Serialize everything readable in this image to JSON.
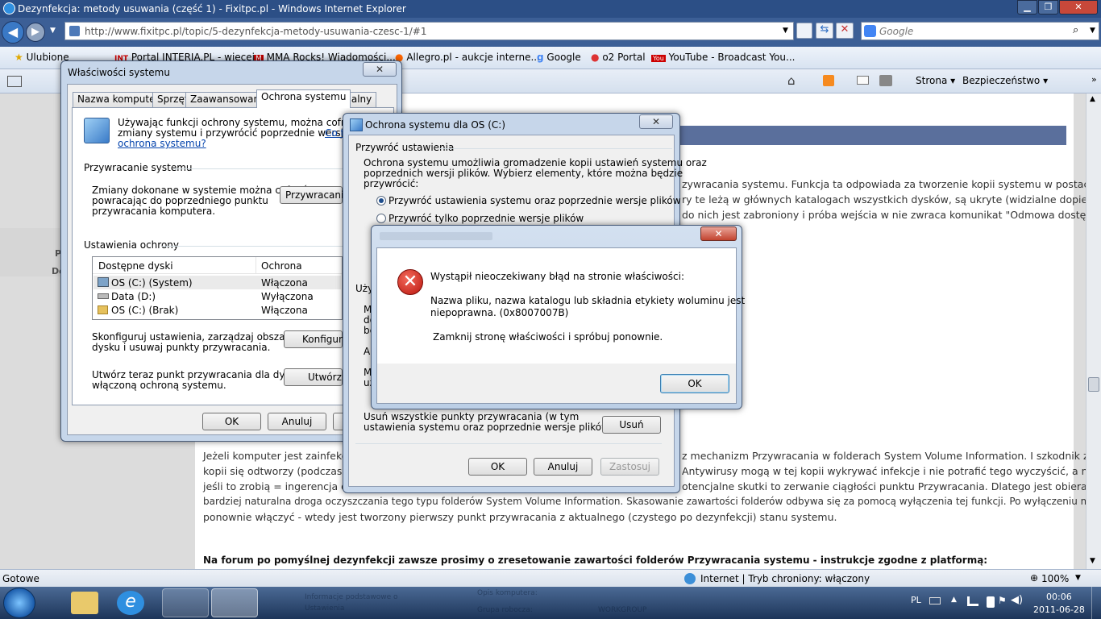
{
  "browser": {
    "title": "Dezynfekcja: metody usuwania (część 1) - Fixitpc.pl - Windows Internet Explorer",
    "url": "http://www.fixitpc.pl/topic/5-dezynfekcja-metody-usuwania-czesc-1/#1",
    "search_placeholder": "Google",
    "favorites_label": "Ulubione",
    "favorites": [
      "Portal INTERIA.PL - więcej...",
      "MMA Rocks! Wiadomości...",
      "Allegro.pl - aukcje interne...",
      "Google",
      "o2 Portal",
      "YouTube - Broadcast You..."
    ],
    "cmd_page": "Strona",
    "cmd_security": "Bezpieczeństwo",
    "status_left": "Gotowe",
    "status_zone": "Internet | Tryb chroniony: włączony",
    "zoom": "100%"
  },
  "page": {
    "right_lines": [
      "zywracania systemu. Funkcja ta odpowiada za tworzenie kopii systemu w postaci tzw.",
      "ry te leżą w głównych katalogach wszystkich dysków, są ukryte (widzialne dopiero po",
      "do nich jest zabroniony i próba wejścia w nie zwraca komunikat \"Odmowa dostępu\"."
    ],
    "bottom_lines": [
      "Jeżeli komputer jest zainfekowa",
      "kopii się odtworzy (podczas pro",
      "jeśli to zrobią = ingerencja opro",
      "bardziej naturalna droga oczyszczania tego typu folderów System Volume Information. Skasowanie zawartości folderów odbywa się za pomocą wyłączenia tej funkcji. Po wyłączeniu można ją",
      "ponownie włączyć - wtedy jest tworzony pierwszy punkt przywracania z aktualnego (czystego po dezynfekcji) stanu systemu."
    ],
    "bottom_right_lines": [
      "z mechanizm Przywracania w folderach System Volume Information. I szkodnik z tej",
      "Antywirusy mogą w tej kopii wykrywać infekcje i nie potrafić tego wyczyścić, a nawet",
      "otencjalne skutki to zerwanie ciągłości punktu Przywracania. Dlatego jest obierana inna,"
    ],
    "bold_line": "Na forum po pomyślnej dezynfekcji zawsze prosimy o zresetowanie zawartości folderów Przywracania systemu - instrukcje zgodne z platformą:",
    "left_frag_1": "P",
    "left_frag_2": "De"
  },
  "sysprops": {
    "title": "Właściwości systemu",
    "tabs": [
      "Nazwa komputera",
      "Sprzęt",
      "Zaawansowane",
      "Ochrona systemu",
      "Zdalny"
    ],
    "intro_line1": "Używając funkcji ochrony systemu, można cofnąć niepożą",
    "intro_line2": "zmiany systemu i przywrócić poprzednie wersje plików.",
    "intro_link_a": "Co t",
    "intro_link_b": "ochrona systemu?",
    "restore_group": "Przywracanie systemu",
    "restore_text_1": "Zmiany dokonane w systemie można cofnąć,",
    "restore_text_2": "powracając do poprzedniego punktu",
    "restore_text_3": "przywracania komputera.",
    "restore_btn": "Przywracanie s",
    "protect_group": "Ustawienia ochrony",
    "col_disks": "Dostępne dyski",
    "col_protection": "Ochrona",
    "drives": [
      {
        "name": "OS (C:) (System)",
        "state": "Włączona"
      },
      {
        "name": "Data (D:)",
        "state": "Wyłączona"
      },
      {
        "name": "OS (C:) (Brak)",
        "state": "Włączona"
      }
    ],
    "config_text_1": "Skonfiguruj ustawienia, zarządzaj obszarem",
    "config_text_2": "dysku i usuwaj punkty przywracania.",
    "config_btn": "Konfiguruj",
    "create_text_1": "Utwórz teraz punkt przywracania dla dysków z",
    "create_text_2": "włączoną ochroną systemu.",
    "create_btn": "Utwórz...",
    "ok": "OK",
    "cancel": "Anuluj"
  },
  "protect": {
    "title": "Ochrona systemu dla OS (C:)",
    "group": "Przywróć ustawienia",
    "text_1": "Ochrona systemu umożliwia gromadzenie kopii ustawień systemu oraz",
    "text_2": "poprzednich wersji plików. Wybierz elementy, które można będzie",
    "text_3": "przywrócić:",
    "radio_1": "Przywróć ustawienia systemu oraz poprzednie wersje plików",
    "radio_2": "Przywróć tylko poprzednie wersje plików",
    "left_frags": [
      "Uży",
      "M",
      "do",
      "be",
      "Al",
      "M",
      "uż"
    ],
    "delete_text_1": "Usuń wszystkie punkty przywracania (w tym",
    "delete_text_2": "ustawienia systemu oraz poprzednie wersje plików).",
    "delete_btn": "Usuń",
    "ok": "OK",
    "cancel": "Anuluj",
    "apply": "Zastosuj"
  },
  "error": {
    "heading": "Wystąpił nieoczekiwany błąd na stronie właściwości:",
    "detail_1": "Nazwa pliku, nazwa katalogu lub składnia etykiety woluminu jest",
    "detail_2": "niepoprawna. (0x8007007B)",
    "advice": "Zamknij stronę właściwości i spróbuj ponownie.",
    "ok": "OK"
  },
  "taskbar": {
    "lang": "PL",
    "time": "00:06",
    "date": "2011-06-28",
    "thumb_1": "Informacje podstawowe o",
    "thumb_2": "Ustawienia",
    "thumb_3": "Opis komputera:",
    "thumb_4": "Grupa robocza:",
    "thumb_5": "WORKGROUP"
  }
}
